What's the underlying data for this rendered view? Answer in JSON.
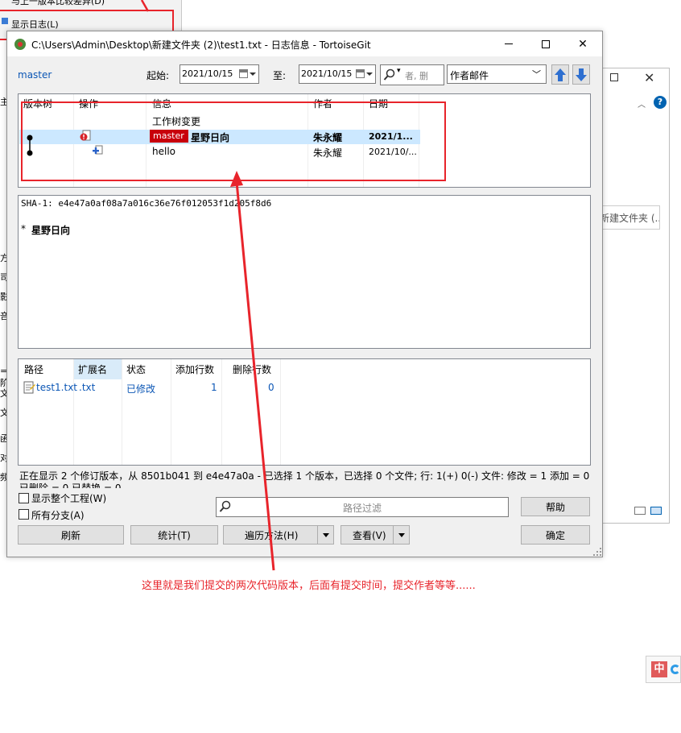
{
  "background": {
    "context_menu": {
      "item_top": "与上一版本比较差异(D)",
      "item_show_log": "显示日志(L)"
    },
    "explorer": {
      "address_fragment": "新建文件夹 (..."
    },
    "left_strip_chars": [
      "主",
      "方",
      "司",
      "影",
      "咅",
      "=阶",
      "文",
      "文",
      "函",
      "对",
      "频"
    ]
  },
  "dialog": {
    "title": "C:\\Users\\Admin\\Desktop\\新建文件夹 (2)\\test1.txt - 日志信息 - TortoiseGit",
    "branch_link": "master",
    "from_label": "起始:",
    "from_date": "2021/10/15",
    "to_label": "至:",
    "to_date": "2021/10/15",
    "search_placeholder": "者, 删",
    "filter_by": "作者邮件",
    "commit_list": {
      "columns": [
        "版本树",
        "操作",
        "信息",
        "作者",
        "日期"
      ],
      "rows": [
        {
          "message": "工作树变更",
          "author": "",
          "date": ""
        },
        {
          "branch": "master",
          "message": "星野日向",
          "author": "朱永耀",
          "date": "2021/1..."
        },
        {
          "message": "hello",
          "author": "朱永耀",
          "date": "2021/10/..."
        }
      ]
    },
    "details": {
      "sha_line": "SHA-1: e4e47a0af08a7a016c36e76f012053f1d205f8d6",
      "message": "星野日向"
    },
    "files": {
      "columns": [
        "路径",
        "扩展名",
        "状态",
        "添加行数",
        "删除行数"
      ],
      "rows": [
        {
          "path": "test1.txt",
          "ext": ".txt",
          "status": "已修改",
          "added": "1",
          "deleted": "0"
        }
      ]
    },
    "status_text": "正在显示 2 个修订版本，从 8501b041 到 e4e47a0a - 已选择 1 个版本，已选择 0 个文件; 行: 1(+) 0(-) 文件: 修改 = 1 添加 = 0 已删除 = 0 已替换 = 0",
    "checkbox_whole_project": "显示整个工程(W)",
    "checkbox_all_branches": "所有分支(A)",
    "path_filter_placeholder": "路径过滤",
    "buttons": {
      "help": "帮助",
      "refresh": "刷新",
      "stats": "统计(T)",
      "walk": "遍历方法(H)",
      "view": "查看(V)",
      "ok": "确定"
    }
  },
  "annotation": {
    "text": "这里就是我们提交的两次代码版本，后面有提交时间，提交作者等等......"
  },
  "ime": {
    "label": "中"
  },
  "colors": {
    "annotation_red": "#e8242b",
    "branch_badge": "#c8000b",
    "link_blue": "#0b56b5",
    "selection": "#cce8ff"
  }
}
